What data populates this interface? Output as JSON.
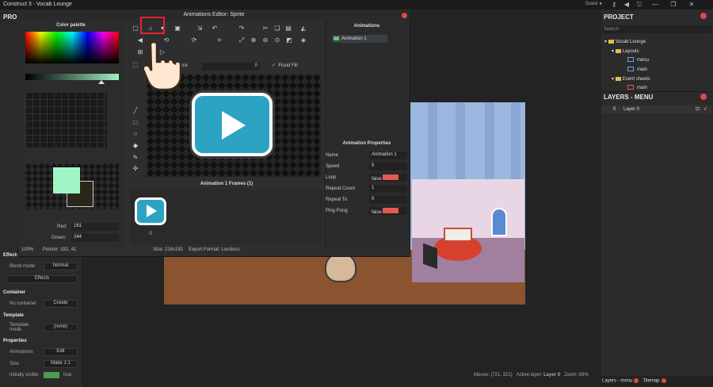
{
  "titlebar": {
    "title": "Construct 3 - Vocab Lounge",
    "guest": "Guest"
  },
  "left": {
    "header": "PRO",
    "effects": "Effects",
    "blend_label": "Blend mode",
    "blend_value": "Normal",
    "effects_btn": "Effects",
    "container": "Container",
    "no_container": "No container",
    "create": "Create",
    "template": "Template",
    "template_mode": "Template mode",
    "template_value": "(none)",
    "properties": "Properties",
    "animations": "Animations",
    "edit": "Edit",
    "size": "Size",
    "make11": "Make 1:1",
    "init_visible": "Initially visible",
    "true": "true"
  },
  "dialog": {
    "title": "Animations Editor: Sprite",
    "palette_title": "Color palette",
    "tolerance_label": "Tolerance",
    "tolerance_value": "0",
    "flood_fill": "Flood Fill",
    "red_label": "Red:",
    "red_value": "161",
    "green_label": "Green:",
    "green_value": "244",
    "zoom": "100%",
    "pointer": "Pointer: 332, 41",
    "size": "Size: 218x181",
    "export": "Export Format: Lossless",
    "frames_title": "Animation 1 Frames (1)",
    "frame_index": "0",
    "animations_title": "Animations",
    "animation_name": "Animation 1",
    "props_title": "Animation Properties",
    "props": [
      {
        "label": "Name",
        "value": "Animation 1"
      },
      {
        "label": "Speed",
        "value": "5"
      },
      {
        "label": "Loop",
        "value": "false"
      },
      {
        "label": "Repeat Count",
        "value": "1"
      },
      {
        "label": "Repeat To",
        "value": "0"
      },
      {
        "label": "Ping Pong",
        "value": "false"
      }
    ]
  },
  "right": {
    "project": "PROJECT",
    "search_placeholder": "Search",
    "tree": {
      "root": "Vocab Lounge",
      "layouts": "Layouts",
      "menu": "menu",
      "main": "main",
      "event_sheets": "Event sheets",
      "main_sheet": "main"
    },
    "layers_title": "LAYERS - MENU",
    "layer_num": "0",
    "layer_name": "Layer 0",
    "tab_layers": "Layers - menu",
    "tab_tilemap": "Tilemap"
  },
  "status": {
    "mouse": "Mouse: (721, 321)",
    "active_layer_label": "Active layer:",
    "active_layer": "Layer 0",
    "zoom": "Zoom: 69%"
  },
  "colors": {
    "accent_red": "#e04848",
    "highlight": "#e3232b",
    "primary_color": "#a1f4c5",
    "play_blue": "#2ca3c3"
  }
}
